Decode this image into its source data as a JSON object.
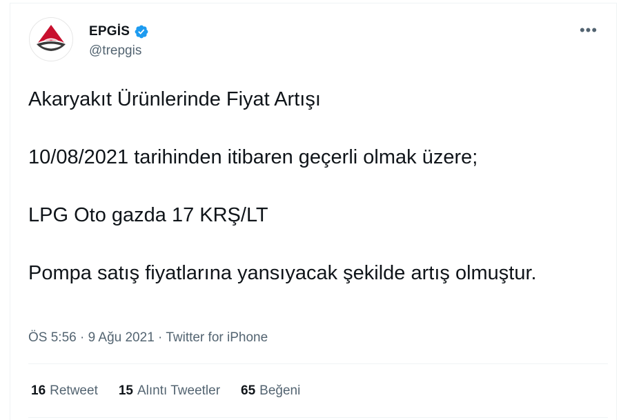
{
  "author": {
    "display_name": "EPGİS",
    "handle": "@trepgis",
    "verified": true,
    "avatar_icon": "epgis-logo-icon"
  },
  "tweet": {
    "paragraphs": [
      "Akaryakıt Ürünlerinde Fiyat Artışı",
      "10/08/2021 tarihinden itibaren geçerli olmak üzere;",
      "LPG Oto gazda 17 KRŞ/LT",
      "Pompa satış fiyatlarına yansıyacak şekilde artış olmuştur."
    ]
  },
  "meta": {
    "time": "ÖS 5:56",
    "separator": "·",
    "date": "9 Ağu 2021",
    "source": "Twitter for iPhone"
  },
  "stats": {
    "retweets": {
      "count": "16",
      "label": "Retweet"
    },
    "quotes": {
      "count": "15",
      "label": "Alıntı Tweetler"
    },
    "likes": {
      "count": "65",
      "label": "Beğeni"
    }
  },
  "colors": {
    "verified_blue": "#1d9bf0",
    "secondary_text": "#536471",
    "primary_text": "#0f1419",
    "logo_red": "#c8102e",
    "logo_dark": "#3a3a3a"
  },
  "more_icon": "more-horizontal-icon"
}
